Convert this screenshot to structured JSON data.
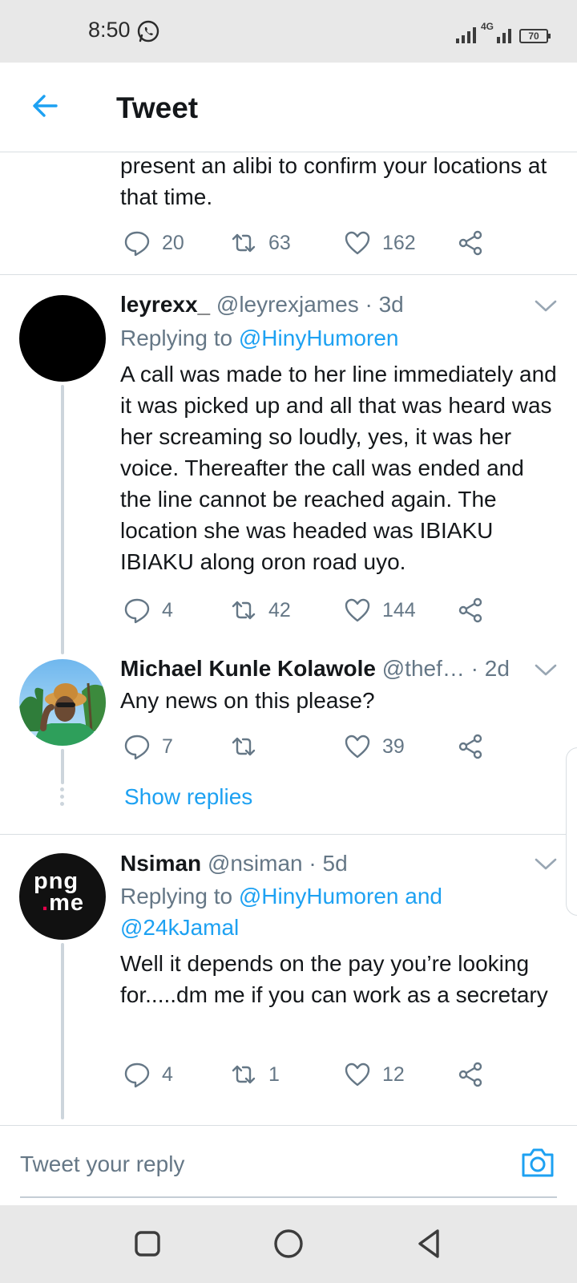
{
  "status_bar": {
    "time": "8:50",
    "network": "4G",
    "battery": "70"
  },
  "header": {
    "title": "Tweet"
  },
  "top_tweet": {
    "text_tail": "present an alibi to confirm your locations at that time.",
    "reply_count": "20",
    "retweet_count": "63",
    "like_count": "162"
  },
  "replies": [
    {
      "display_name": "leyrexx_",
      "handle": "@leyrexjames",
      "time": "· 3d",
      "replying_prefix": "Replying to",
      "replying_to": "@HinyHumoren",
      "text": "A call was made to her line immediately and it was picked up and all that was heard was her screaming so loudly, yes, it was her voice. Thereafter the call was ended and the line cannot be reached again. The location she was headed was IBIAKU IBIAKU along oron road uyo.",
      "reply_count": "4",
      "retweet_count": "42",
      "like_count": "144"
    },
    {
      "display_name": "Michael Kunle Kolawole",
      "handle": "@thef…",
      "time": "· 2d",
      "text": "Any news on this please?",
      "reply_count": "7",
      "retweet_count": "",
      "like_count": "39",
      "show_replies": "Show replies"
    },
    {
      "display_name": "Nsiman",
      "handle": "@nsiman",
      "time": "· 5d",
      "replying_prefix": "Replying to",
      "replying_to": "@HinyHumoren and @24kJamal",
      "avatar_text": [
        "png",
        "me"
      ],
      "text": "Well it depends on the pay you’re looking for.....dm me if you can work as a secretary",
      "reply_count": "4",
      "retweet_count": "1",
      "like_count": "12"
    }
  ],
  "reply_bar": {
    "placeholder": "Tweet your reply"
  },
  "colors": {
    "accent": "#1da1f2",
    "secondary_text": "#657786",
    "primary_text": "#14171a",
    "divider": "#d9dee2"
  }
}
